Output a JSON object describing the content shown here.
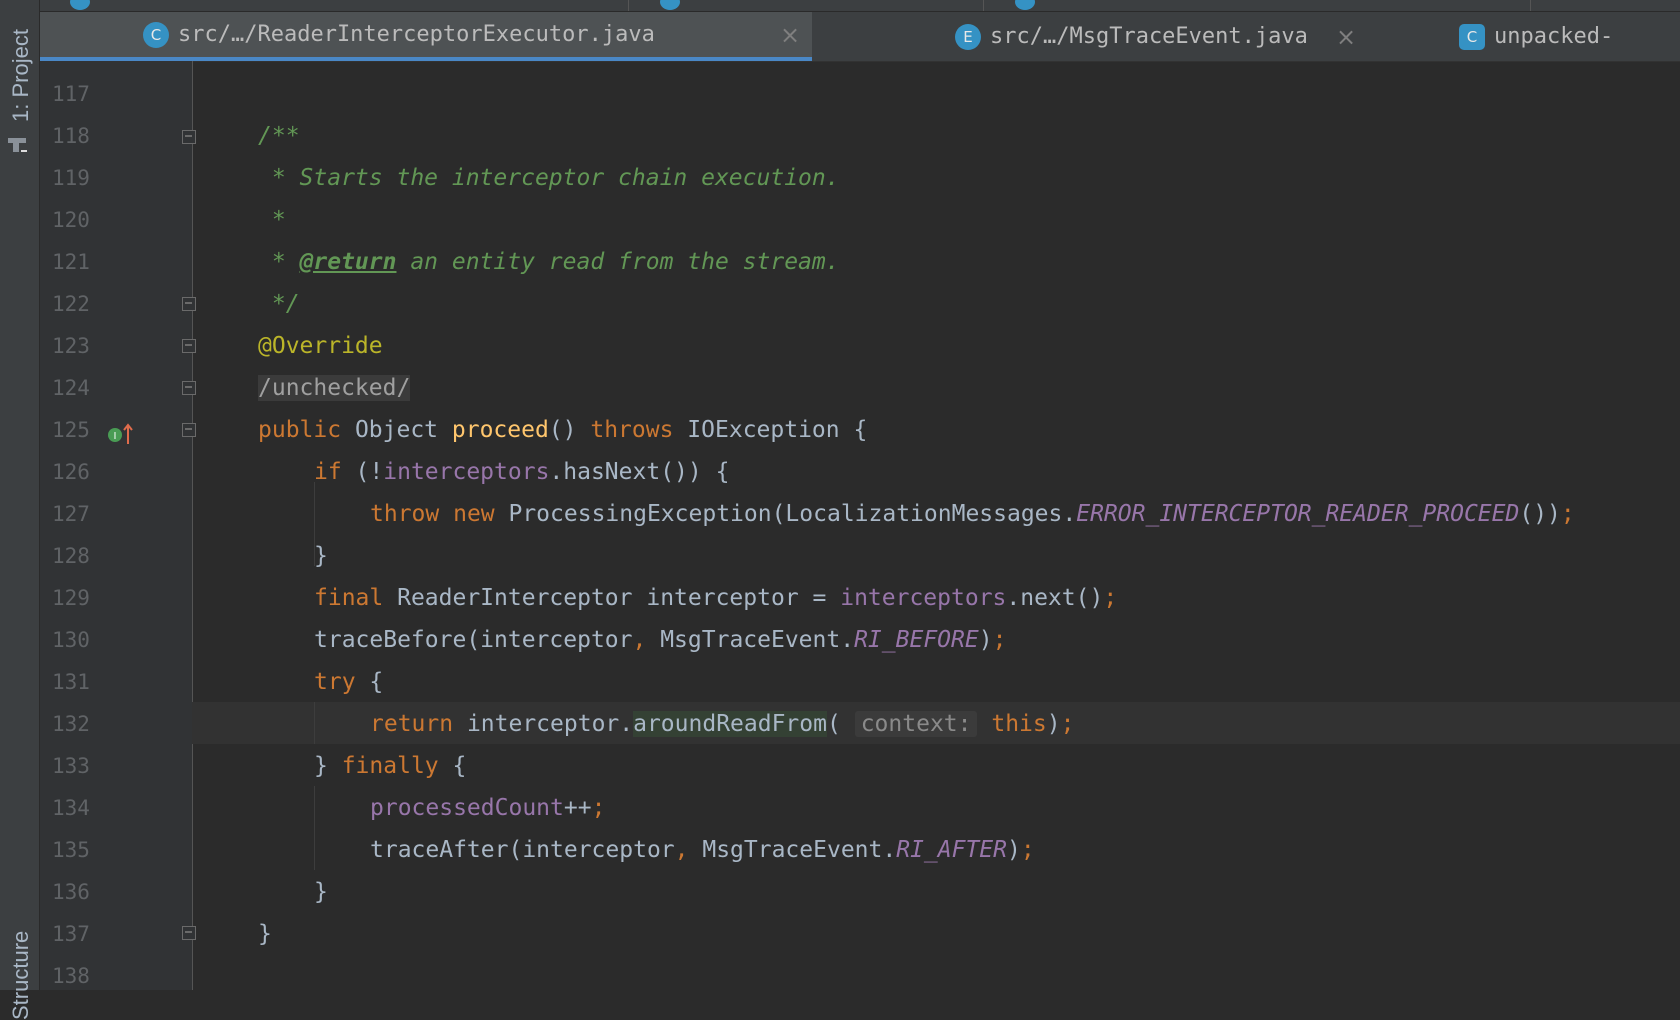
{
  "tool_windows": {
    "project_label": "1: Project",
    "structure_label": "Structure"
  },
  "tabs": [
    {
      "icon": "C",
      "label": "src/…/ReaderInterceptorExecutor.java",
      "close": "×"
    },
    {
      "icon": "E",
      "label": "src/…/MsgTraceEvent.java",
      "close": "×"
    },
    {
      "icon": "C",
      "label": "unpacked-"
    }
  ],
  "editor": {
    "line_numbers": [
      "117",
      "118",
      "119",
      "120",
      "121",
      "122",
      "123",
      "124",
      "125",
      "126",
      "127",
      "128",
      "129",
      "130",
      "131",
      "132",
      "133",
      "134",
      "135",
      "136",
      "137",
      "138"
    ],
    "lines": {
      "l118": {
        "doc": "/**"
      },
      "l119": {
        "doc": " * Starts the interceptor chain execution."
      },
      "l120": {
        "doc": " *"
      },
      "l121": {
        "prefix": " * ",
        "tag": "@return",
        "rest": " an entity read from the stream."
      },
      "l122": {
        "doc": " */"
      },
      "l123": {
        "annotation": "@Override"
      },
      "l124": {
        "suppress": "/unchecked/"
      },
      "l125": {
        "kw_public": "public",
        "type": " Object ",
        "method": "proceed",
        "paren": "() ",
        "kw_throws": "throws",
        "exc": " IOException {"
      },
      "l126": {
        "kw_if": "if",
        "open": " (!",
        "field": "interceptors",
        "rest": ".hasNext()) {"
      },
      "l127": {
        "kw_throw": "throw",
        "kw_new": " new",
        "call": " ProcessingException(LocalizationMessages.",
        "const": "ERROR_INTERCEPTOR_READER_PROCEED",
        "end": "())",
        "semi": ";"
      },
      "l128": {
        "text": "}"
      },
      "l129": {
        "kw_final": "final",
        "decl": " ReaderInterceptor interceptor = ",
        "field": "interceptors",
        "rest": ".next()",
        "semi": ";"
      },
      "l130": {
        "call": "traceBefore(interceptor",
        "comma": ",",
        "cls": " MsgTraceEvent.",
        "const": "RI_BEFORE",
        "end": ")",
        "semi": ";"
      },
      "l131": {
        "kw_try": "try",
        "rest": " {"
      },
      "l132": {
        "kw_return": "return",
        "obj": " interceptor.",
        "method": "aroundReadFrom",
        "paren": "(",
        "hint": "context:",
        "kw_this": "this",
        "end": ")",
        "semi": ";"
      },
      "l133": {
        "brace": "} ",
        "kw_finally": "finally",
        "rest": " {"
      },
      "l134": {
        "field": "processedCount",
        "op": "++",
        "semi": ";"
      },
      "l135": {
        "call": "traceAfter(interceptor",
        "comma": ",",
        "cls": " MsgTraceEvent.",
        "const": "RI_AFTER",
        "end": ")",
        "semi": ";"
      },
      "l136": {
        "text": "}"
      },
      "l137": {
        "text": "}"
      }
    }
  },
  "colors": {
    "keyword": "#cc7832",
    "doc_comment": "#629755",
    "annotation": "#bbb529",
    "field": "#9876aa",
    "method_decl": "#ffc66d",
    "text": "#a9b7c6",
    "accent": "#4a88c7",
    "file_icon": "#3592c4"
  },
  "icons": [
    "project-icon",
    "class-file-icon",
    "enum-file-icon",
    "close-icon",
    "implements-method-icon",
    "fold-icon"
  ]
}
